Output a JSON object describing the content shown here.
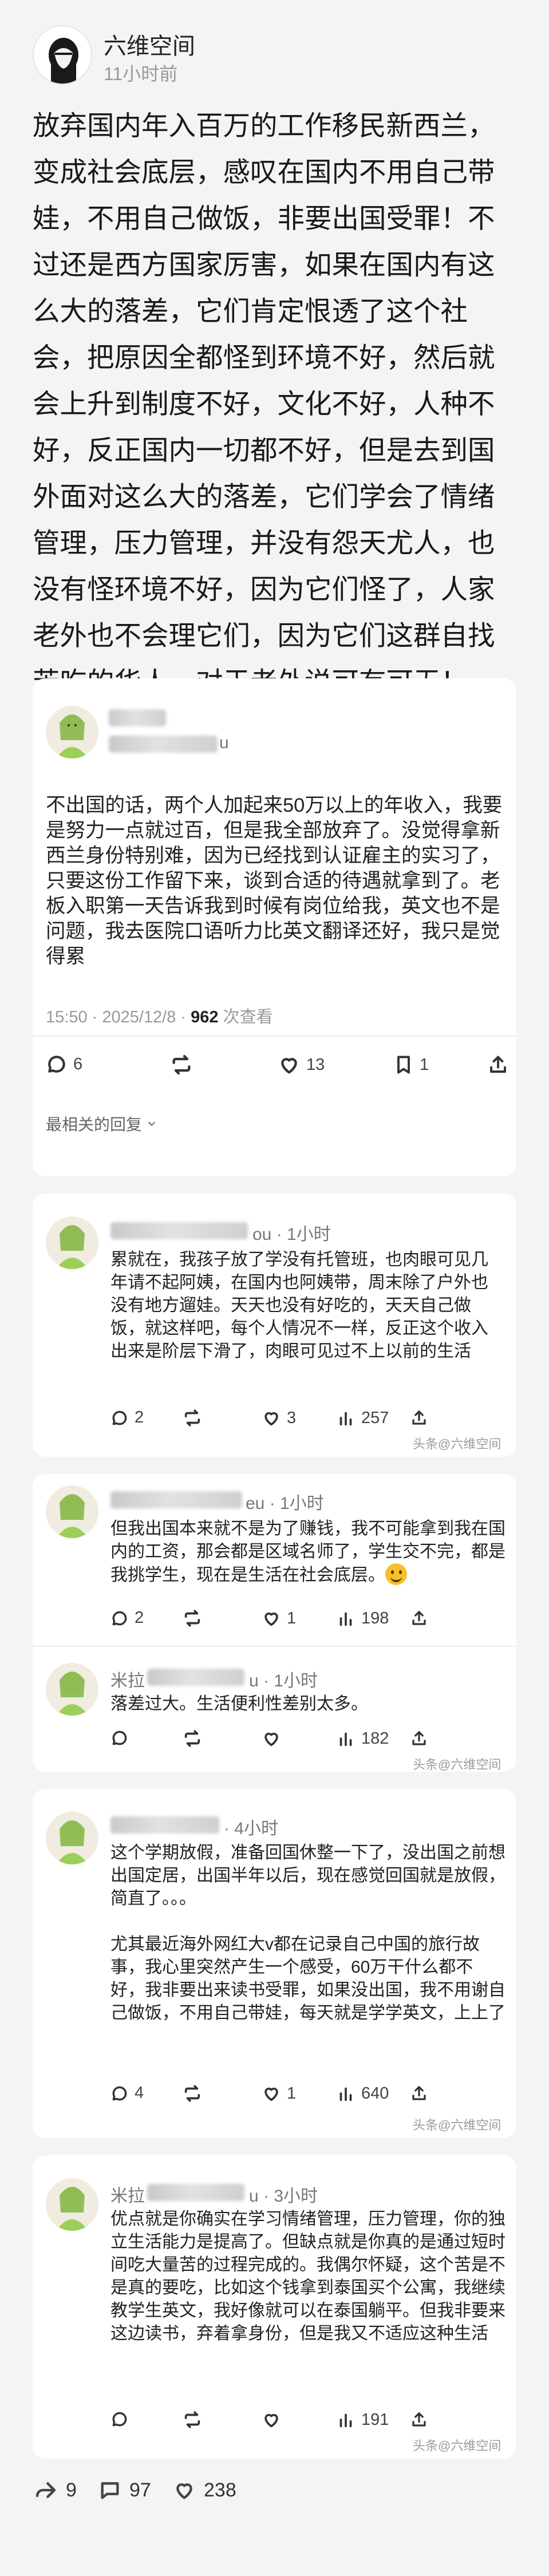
{
  "post": {
    "author": "六维空间",
    "time": "11小时前",
    "text": "放弃国内年入百万的工作移民新西兰，变成社会底层，感叹在国内不用自己带娃，不用自己做饭，非要出国受罪！不过还是西方国家厉害，如果在国内有这么大的落差，它们肯定恨透了这个社会，把原因全都怪到环境不好，然后就会上升到制度不好，文化不好，人种不好，反正国内一切都不好，但是去到国外面对这么大的落差，它们学会了情绪管理，压力管理，并没有怨天尤人，也没有怪环境不好，因为它们怪了，人家老外也不会理它们，因为它们这群自找苦吃的华人，对于老外说可有可无！"
  },
  "quoted": {
    "name_suffix": "u",
    "text": "不出国的话，两个人加起来50万以上的年收入，我要是努力一点就过百，但是我全部放弃了。没觉得拿新西兰身份特别难，因为已经找到认证雇主的实习了，只要这份工作留下来，谈到合适的待遇就拿到了。老板入职第一天告诉我到时候有岗位给我，英文也不是问题，我去医院口语听力比英文翻译还好，我只是觉得累",
    "datetime": "15:50 · 2025/12/8 · ",
    "views": "962",
    "views_suffix": " 次查看",
    "replies": "6",
    "likes": "13",
    "bookmarks": "1",
    "section_title": "最相关的回复",
    "watermark": "头条@六维空间"
  },
  "replies": [
    {
      "name_suffix": "ou · 1小时",
      "text": "累就在，我孩子放了学没有托管班，也肉眼可见几年请不起阿姨，在国内也阿姨带，周末除了户外也没有地方遛娃。天天也没有好吃的，天天自己做饭，就这样吧，每个人情况不一样，反正这个收入出来是阶层下滑了，肉眼可见过不上以前的生活",
      "replies": "2",
      "likes": "3",
      "views": "257"
    },
    {
      "name_suffix": "eu · 1小时",
      "text": "但我出国本来就不是为了赚钱，我不可能拿到我在国内的工资，那会都是区域名师了，学生交不完，都是我挑学生，现在是生活在社会底层。",
      "replies": "2",
      "likes": "1",
      "views": "198"
    },
    {
      "name_prefix": "米拉",
      "name_suffix": "u · 1小时",
      "text": "落差过大。生活便利性差别太多。",
      "replies": "",
      "likes": "",
      "views": "182"
    },
    {
      "name_suffix": "· 4小时",
      "text": "这个学期放假，准备回国休整一下了，没出国之前想出国定居，出国半年以后，现在感觉回国就是放假，简直了。。。\n\n尤其最近海外网红大v都在记录自己中国的旅行故事，我心里突然产生一个感受，60万干什么都不好，我非要出来读书受罪，如果没出国，我不用谢自己做饭，不用自己带娃，每天就是学学英文，上上了",
      "replies": "4",
      "likes": "1",
      "views": "640"
    },
    {
      "name_prefix": "米拉",
      "name_suffix": "u · 3小时",
      "text": "优点就是你确实在学习情绪管理，压力管理，你的独立生活能力是提高了。但缺点就是你真的是通过短时间吃大量苦的过程完成的。我偶尔怀疑，这个苦是不是真的要吃，比如这个钱拿到泰国买个公寓，我继续教学生英文，我好像就可以在泰国躺平。但我非要来这边读书，弃着拿身份，但是我又不适应这种生活",
      "replies": "",
      "likes": "",
      "views": "191"
    }
  ],
  "bottom": {
    "shares": "9",
    "comments": "97",
    "likes": "238"
  }
}
